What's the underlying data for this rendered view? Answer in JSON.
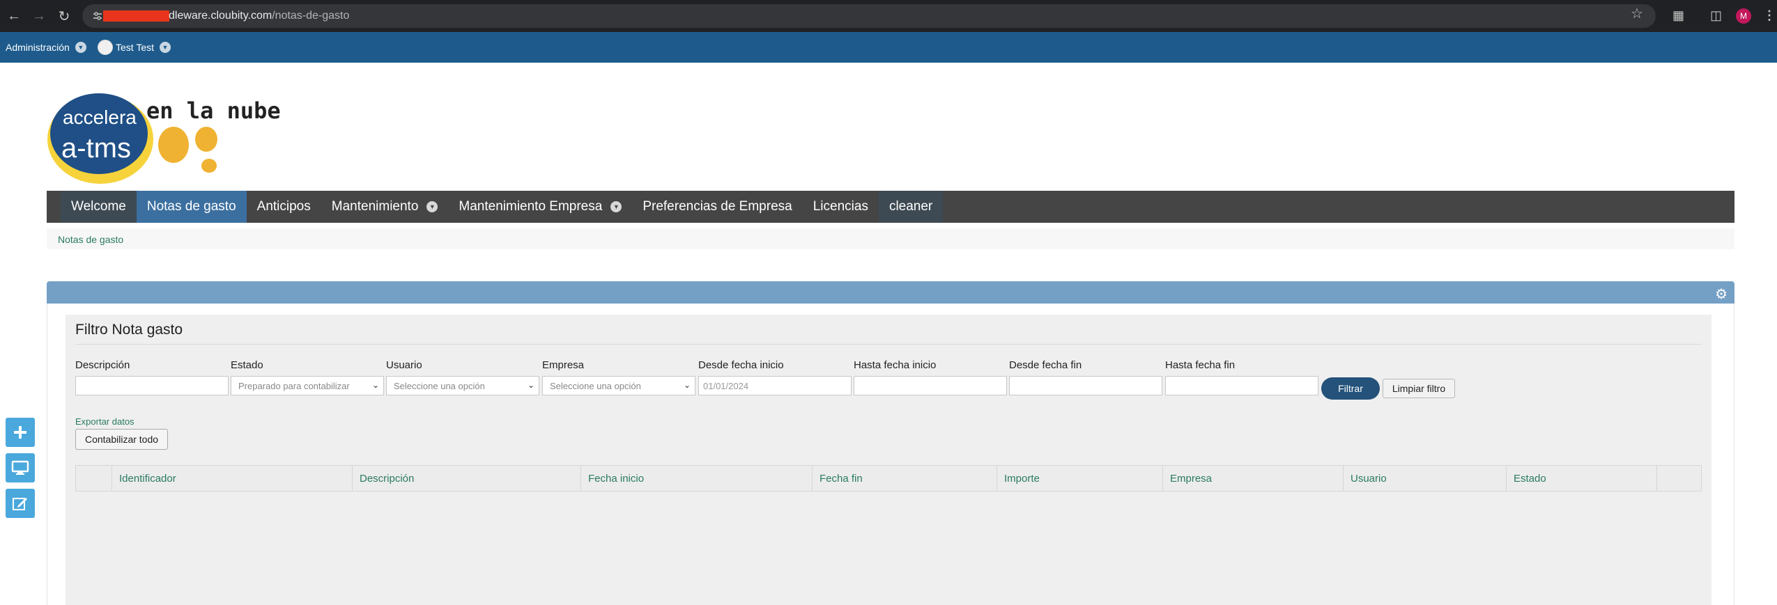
{
  "browser": {
    "url_domain": "dleware.cloubity.com",
    "url_path": "/notas-de-gasto",
    "profile_initial": "M",
    "icons": [
      "back-icon",
      "forward-icon",
      "reload-icon",
      "tune-icon",
      "star-icon",
      "extensions-icon",
      "sidepanel-icon",
      "menu-icon"
    ]
  },
  "topbar": {
    "admin_label": "Administración",
    "user_label": "Test Test"
  },
  "logo": {
    "brand_top": "accelera",
    "brand_bottom": "a-tms",
    "tagline": "en la nube"
  },
  "mainnav": {
    "items": [
      {
        "label": "Welcome"
      },
      {
        "label": "Notas de gasto"
      },
      {
        "label": "Anticipos"
      },
      {
        "label": "Mantenimiento"
      },
      {
        "label": "Mantenimiento Empresa"
      },
      {
        "label": "Preferencias de Empresa"
      },
      {
        "label": "Licencias"
      },
      {
        "label": "cleaner"
      }
    ]
  },
  "breadcrumb": "Notas de gasto",
  "filter": {
    "title": "Filtro Nota gasto",
    "fields": {
      "descripcion_label": "Descripción",
      "estado_label": "Estado",
      "estado_value": "Preparado para contabilizar",
      "usuario_label": "Usuario",
      "usuario_value": "Seleccione una opción",
      "empresa_label": "Empresa",
      "empresa_value": "Seleccione una opción",
      "desde_inicio_label": "Desde fecha inicio",
      "desde_inicio_value": "01/01/2024",
      "hasta_inicio_label": "Hasta fecha inicio",
      "desde_fin_label": "Desde fecha fin",
      "hasta_fin_label": "Hasta fecha fin"
    },
    "filtrar_label": "Filtrar",
    "limpiar_label": "Limpiar filtro"
  },
  "actions": {
    "export_label": "Exportar datos",
    "contabilizar_label": "Contabilizar todo"
  },
  "table": {
    "columns": [
      "",
      "Identificador",
      "Descripción",
      "Fecha inicio",
      "Fecha fin",
      "Importe",
      "Empresa",
      "Usuario",
      "Estado",
      ""
    ]
  },
  "colors": {
    "topbar": "#1e5b8c",
    "mainnav": "#454545",
    "nav_active": "#3b6f9f",
    "panel_header": "#75a0c6",
    "link_green": "#2a7a63",
    "side_button": "#4aa8dc"
  }
}
